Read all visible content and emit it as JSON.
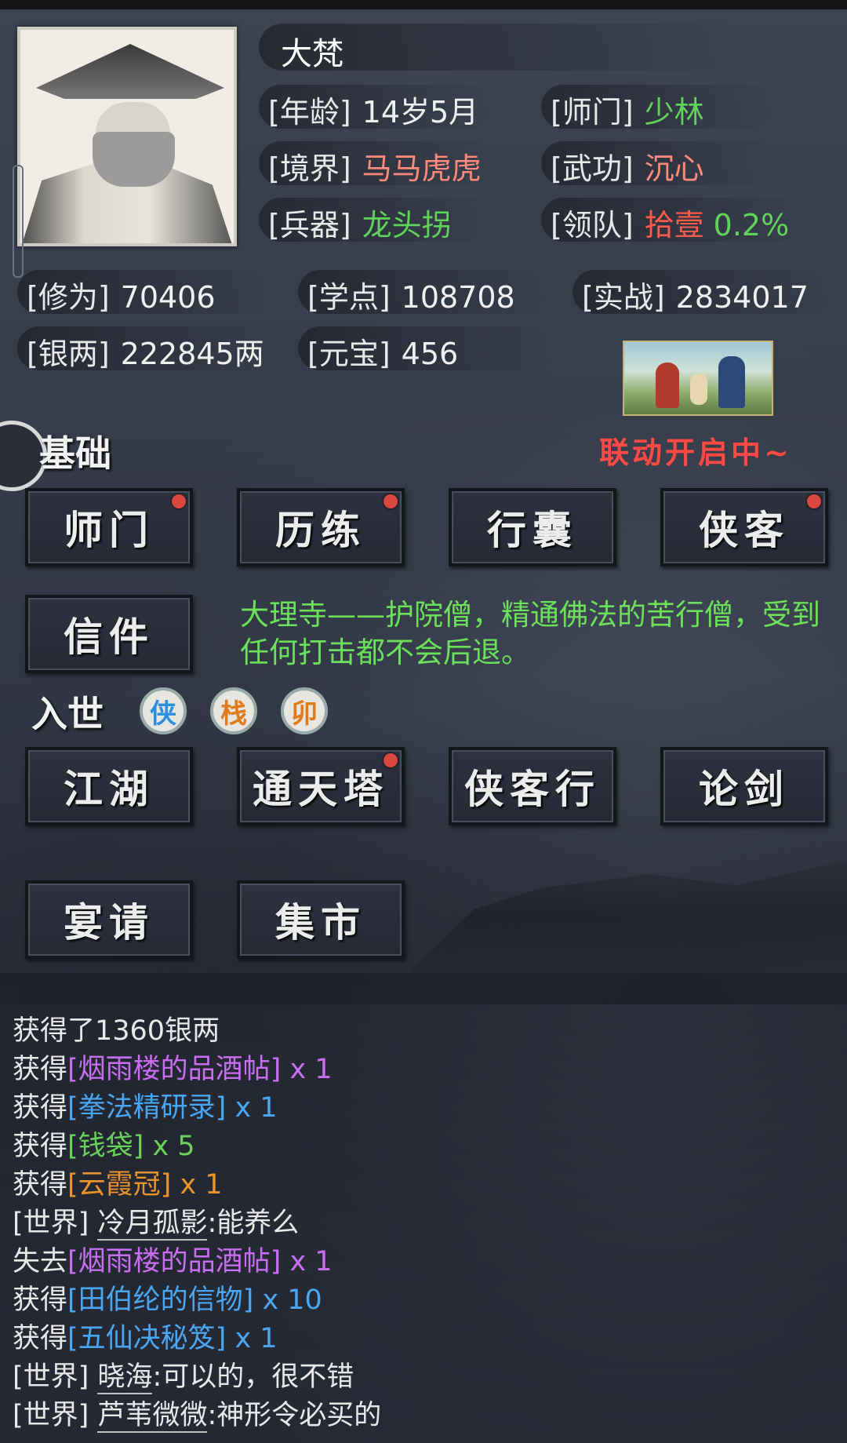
{
  "player": {
    "name": "大梵"
  },
  "attributes": {
    "age": {
      "label": "[年龄]",
      "value": "14岁5月"
    },
    "school": {
      "label": "[师门]",
      "value": "少林"
    },
    "realm": {
      "label": "[境界]",
      "value": "马马虎虎"
    },
    "martial": {
      "label": "[武功]",
      "value": "沉心"
    },
    "weapon": {
      "label": "[兵器]",
      "value": "龙头拐"
    },
    "team": {
      "label": "[领队]",
      "value": "拾壹",
      "percent": "0.2%"
    }
  },
  "stats": {
    "cultivation": {
      "label": "[修为]",
      "value": "70406"
    },
    "study": {
      "label": "[学点]",
      "value": "108708"
    },
    "combat": {
      "label": "[实战]",
      "value": "2834017"
    },
    "silver": {
      "label": "[银两]",
      "value": "222845两"
    },
    "ingot": {
      "label": "[元宝]",
      "value": "456"
    }
  },
  "collab_text": "联动开启中~",
  "basic": {
    "title": "基础",
    "buttons": [
      "师门",
      "历练",
      "行囊",
      "侠客",
      "信件"
    ]
  },
  "description": "大理寺——护院僧，精通佛法的苦行僧，受到任何打击都不会后退。",
  "world": {
    "title": "入世",
    "icons": [
      "侠",
      "栈",
      "卯"
    ],
    "buttons": [
      "江湖",
      "通天塔",
      "侠客行",
      "论剑",
      "宴请",
      "集市"
    ]
  },
  "log": {
    "l1_a": "获得了1360银两",
    "l2_a": "获得",
    "l2_b": "[烟雨楼的品酒帖]",
    "l2_c": " x 1",
    "l3_a": "获得",
    "l3_b": "[拳法精研录]",
    "l3_c": " x 1",
    "l4_a": "获得",
    "l4_b": "[钱袋]",
    "l4_c": " x 5",
    "l5_a": "获得",
    "l5_b": "[云霞冠]",
    "l5_c": " x 1",
    "l6_a": "[世界] ",
    "l6_b": "冷月孤影",
    "l6_c": ":能养么",
    "l7_a": "失去",
    "l7_b": "[烟雨楼的品酒帖]",
    "l7_c": " x 1",
    "l8_a": "获得",
    "l8_b": "[田伯纶的信物]",
    "l8_c": " x 10",
    "l9_a": "获得",
    "l9_b": "[五仙决秘笈]",
    "l9_c": " x 1",
    "l10_a": "[世界] ",
    "l10_b": "晓海",
    "l10_c": ":可以的，很不错",
    "l11_a": "[世界] ",
    "l11_b": "芦苇微微",
    "l11_c": ":神形令必买的"
  }
}
